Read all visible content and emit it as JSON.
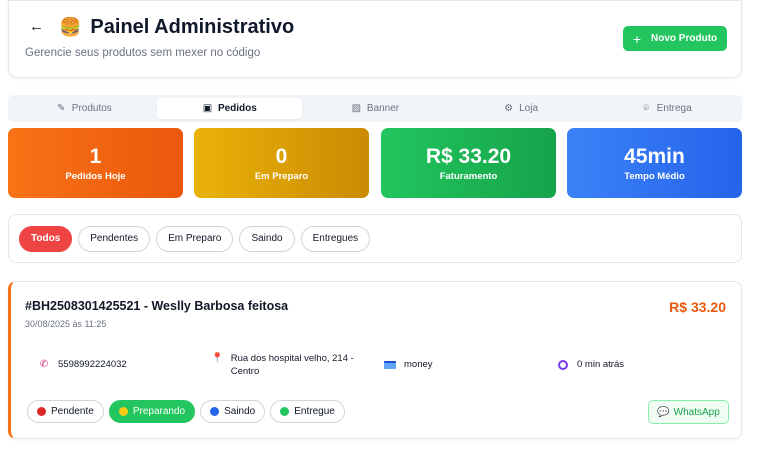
{
  "header": {
    "back_icon": "arrow-left-icon",
    "title_emoji": "🍔",
    "title": "Painel Administrativo",
    "subtitle": "Gerencie seus produtos sem mexer no código",
    "new_product_label": "Novo Produto"
  },
  "tabs": [
    {
      "label": "Produtos",
      "icon": "edit-icon"
    },
    {
      "label": "Pedidos",
      "icon": "shopping-bag-icon",
      "active": true
    },
    {
      "label": "Banner",
      "icon": "image-icon"
    },
    {
      "label": "Loja",
      "icon": "gear-icon"
    },
    {
      "label": "Entrega",
      "icon": "map-pin-icon"
    }
  ],
  "stats": [
    {
      "value": "1",
      "label": "Pedidos Hoje",
      "color": "#f97316"
    },
    {
      "value": "0",
      "label": "Em Preparo",
      "color": "#eab308"
    },
    {
      "value": "R$ 33.20",
      "label": "Faturamento",
      "color": "#22c55e"
    },
    {
      "value": "45min",
      "label": "Tempo Médio",
      "color": "#3b82f6"
    }
  ],
  "filters": [
    {
      "label": "Todos",
      "active": true
    },
    {
      "label": "Pendentes"
    },
    {
      "label": "Em Preparo"
    },
    {
      "label": "Saindo"
    },
    {
      "label": "Entregues"
    }
  ],
  "order": {
    "title": "#BH2508301425521 - Weslly Barbosa feitosa",
    "date": "30/08/2025 às 11:25",
    "total": "R$ 33.20",
    "phone": "5598992224032",
    "address": "Rua dos hospital velho, 214 - Centro",
    "payment": "money",
    "time_ago": "0 min atrás",
    "statuses": [
      {
        "label": "Pendente",
        "dot_color": "#dc2626"
      },
      {
        "label": "Preparando",
        "dot_color": "#facc15",
        "active": true
      },
      {
        "label": "Saindo",
        "dot_color": "#2563eb"
      },
      {
        "label": "Entregue",
        "dot_color": "#22c55e"
      }
    ],
    "whatsapp_label": "WhatsApp"
  },
  "colors": {
    "accent_green": "#22c55e",
    "accent_red": "#ef4444",
    "price_orange": "#ea580c"
  }
}
